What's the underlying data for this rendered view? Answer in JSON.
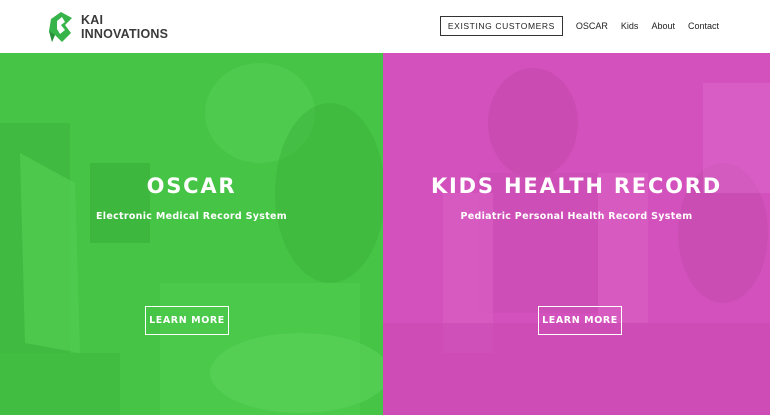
{
  "brand": {
    "line1": "KAI",
    "line2": "INNOVATIONS",
    "logo_icon": "kai-leaf-logo",
    "logo_color": "#36b44a"
  },
  "nav": {
    "customers_label": "EXISTING CUSTOMERS",
    "links": [
      "OSCAR",
      "Kids",
      "About",
      "Contact"
    ]
  },
  "panels": [
    {
      "title": "OSCAR",
      "subtitle": "Electronic Medical Record System",
      "button_label": "LEARN MORE",
      "color": "#45c445"
    },
    {
      "title": "KIDS HEALTH RECORD",
      "subtitle": "Pediatric Personal Health Record System",
      "button_label": "LEARN MORE",
      "color": "#d351bd"
    }
  ]
}
